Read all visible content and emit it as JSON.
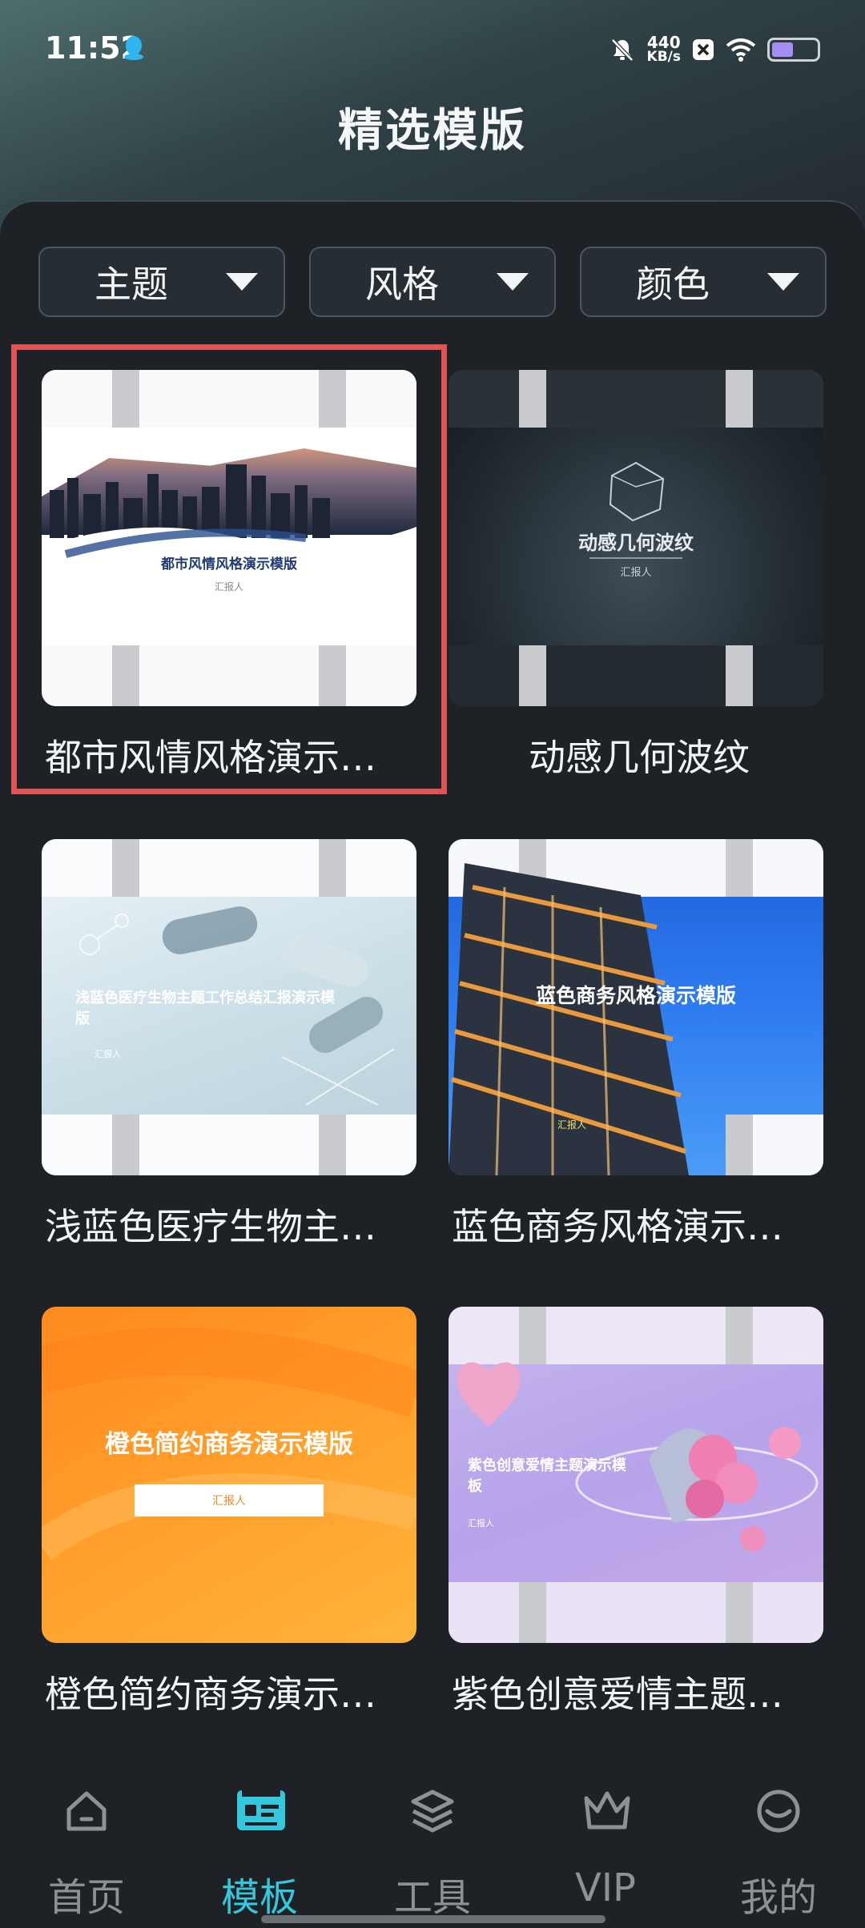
{
  "status": {
    "time": "11:52",
    "net_speed_value": "440",
    "net_speed_unit": "KB/s"
  },
  "page_title": "精选模版",
  "filters": [
    {
      "label": "主题"
    },
    {
      "label": "风格"
    },
    {
      "label": "颜色"
    }
  ],
  "templates": [
    {
      "title": "都市风情风格演示…",
      "cover_title": "都市风情风格演示模版",
      "cover_sub": "汇报人",
      "selected": true
    },
    {
      "title": "动感几何波纹",
      "cover_title": "动感几何波纹",
      "cover_sub": "汇报人",
      "selected": false
    },
    {
      "title": "浅蓝色医疗生物主…",
      "cover_title": "浅蓝色医疗生物主题工作总结汇报演示模版",
      "cover_sub": "汇报人",
      "selected": false
    },
    {
      "title": "蓝色商务风格演示…",
      "cover_title": "蓝色商务风格演示模版",
      "cover_sub": "汇报人",
      "selected": false
    },
    {
      "title": "橙色简约商务演示…",
      "cover_title": "橙色简约商务演示模版",
      "cover_sub": "汇报人",
      "selected": false
    },
    {
      "title": "紫色创意爱情主题…",
      "cover_title": "紫色创意爱情主题演示模板",
      "cover_sub": "汇报人",
      "selected": false
    }
  ],
  "nav": {
    "items": [
      {
        "label": "首页",
        "icon": "home-icon"
      },
      {
        "label": "模板",
        "icon": "template-icon",
        "active": true
      },
      {
        "label": "工具",
        "icon": "layers-icon"
      },
      {
        "label": "VIP",
        "icon": "crown-icon"
      },
      {
        "label": "我的",
        "icon": "profile-icon"
      }
    ]
  },
  "colors": {
    "accent": "#35c7dc",
    "selected_border": "#e05454",
    "background": "#1e2227"
  }
}
